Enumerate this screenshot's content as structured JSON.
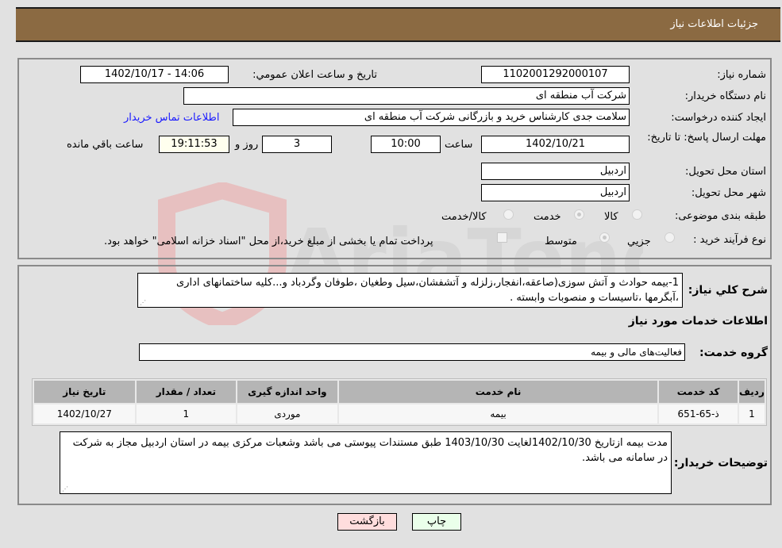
{
  "header": {
    "title": "جزئیات اطلاعات نیاز"
  },
  "fields": {
    "need_number_label": "شماره نیاز:",
    "need_number": "1102001292000107",
    "announce_label": "تاریخ و ساعت اعلان عمومي:",
    "announce_value": "1402/10/17 - 14:06",
    "buyer_org_label": "نام دستگاه خریدار:",
    "buyer_org": "شرکت آب منطقه ای",
    "creator_label": "ایجاد کننده درخواست:",
    "creator": "سلامت جدی کارشناس خرید و بازرگانی شرکت آب منطقه ای",
    "contact_link": "اطلاعات تماس خریدار",
    "deadline_label": "مهلت ارسال پاسخ: تا تاریخ:",
    "deadline_date": "1402/10/21",
    "time_label": "ساعت",
    "deadline_time": "10:00",
    "days_value": "3",
    "days_label": "روز و",
    "remaining_time": "19:11:53",
    "remaining_label": "ساعت باقي مانده",
    "province_label": "استان محل تحویل:",
    "province": "اردبیل",
    "city_label": "شهر محل تحویل:",
    "city": "اردبیل",
    "category_label": "طبقه بندی موضوعی:",
    "category_options": [
      {
        "label": "کالا",
        "selected": false
      },
      {
        "label": "خدمت",
        "selected": true
      },
      {
        "label": "کالا/خدمت",
        "selected": false
      }
    ],
    "process_label": "نوع فرآیند خرید :",
    "process_options": [
      {
        "label": "جزيي",
        "selected": false
      },
      {
        "label": "متوسط",
        "selected": true
      }
    ],
    "treasury_note": "پرداخت تمام یا بخشی از مبلغ خرید،از محل \"اسناد خزانه اسلامی\" خواهد بود.",
    "treasury_checked": false
  },
  "description": {
    "label": "شرح کلي نیاز:",
    "text": "1-بیمه حوادث و آتش سوزی(صاعقه،انفجار،زلزله و آتشفشان،سیل وطغیان ،طوفان وگردباد و...کلیه ساختمانهای اداری ،آبگرمها ،تاسیسات و منصوبات وابسته ."
  },
  "services": {
    "section_title": "اطلاعات خدمات مورد نیاز",
    "group_label": "گروه خدمت:",
    "group_value": "فعالیت‌های مالی و بیمه",
    "columns": [
      "ردیف",
      "کد خدمت",
      "نام خدمت",
      "واحد اندازه گیری",
      "تعداد / مقدار",
      "تاریخ نیاز"
    ],
    "rows": [
      [
        "1",
        "ذ-65-651",
        "بیمه",
        "موردی",
        "1",
        "1402/10/27"
      ]
    ]
  },
  "buyer_notes": {
    "label": "توضیحات خریدار:",
    "text": "مدت بیمه ازتاریخ 1402/10/30لغایت 1403/10/30 طبق مستندات پیوستی می باشد وشعبات مرکزی بیمه در استان اردبیل مجاز به شرکت در سامانه می باشد."
  },
  "buttons": {
    "print": "چاپ",
    "back": "بازگشت"
  },
  "watermark": {
    "text": "AriaTender.net"
  },
  "colors": {
    "header_bg": "#8b6a42",
    "print_bg": "#eaffea",
    "back_bg": "#ffdddd",
    "link": "#1a1aff"
  }
}
